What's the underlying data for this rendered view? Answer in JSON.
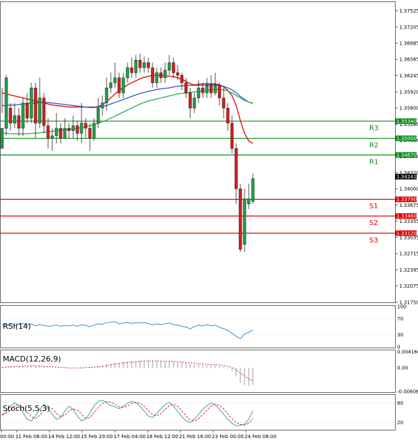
{
  "chart_data": {
    "type": "candlestick",
    "title": "",
    "colors": {
      "bull": "#22a24a",
      "bear": "#d62020",
      "ma_fast": "#e01010",
      "ma_mid": "#3a5fd0",
      "ma_slow": "#36b060",
      "support": "#e00000",
      "resistance": "#0a8a1a",
      "rsi_line": "#3b8fd9",
      "macd_signal": "#e02020",
      "macd_hist": "#999999",
      "stoch_k": "#3aa3a3",
      "stoch_d": "#e02020",
      "price_label_bg": "#000000"
    },
    "y_axis": {
      "ticks": [
        "1.37525",
        "1.37205",
        "1.36885",
        "1.36565",
        "1.36245",
        "1.35920",
        "1.35600",
        "1.35280",
        "1.34960",
        "1.34640",
        "1.34320",
        "1.34000",
        "1.33675",
        "1.33355",
        "1.33035",
        "1.32715",
        "1.32395",
        "1.32075",
        "1.31750"
      ],
      "ylim": [
        1.3175,
        1.377
      ]
    },
    "x_axis": {
      "labels": [
        "00:00",
        "11 Feb 08:00",
        "14 Feb 12:00",
        "15 Feb 20:00",
        "17 Feb 04:00",
        "18 Feb 12:00",
        "21 Feb 16:00",
        "23 Feb 00:00",
        "24 Feb 08:00"
      ]
    },
    "candles": [
      [
        1.348,
        1.352,
        1.355,
        1.36
      ],
      [
        1.352,
        1.362,
        1.3625,
        1.3505
      ],
      [
        1.356,
        1.353,
        1.357,
        1.3515
      ],
      [
        1.353,
        1.3545,
        1.357,
        1.352
      ],
      [
        1.3545,
        1.352,
        1.356,
        1.3505
      ],
      [
        1.352,
        1.357,
        1.358,
        1.3505
      ],
      [
        1.357,
        1.354,
        1.359,
        1.353
      ],
      [
        1.354,
        1.36,
        1.361,
        1.353
      ],
      [
        1.36,
        1.353,
        1.361,
        1.35
      ],
      [
        1.353,
        1.358,
        1.362,
        1.352
      ],
      [
        1.358,
        1.3525,
        1.359,
        1.351
      ],
      [
        1.3525,
        1.35,
        1.354,
        1.348
      ],
      [
        1.35,
        1.3505,
        1.352,
        1.3475
      ],
      [
        1.3505,
        1.352,
        1.355,
        1.349
      ],
      [
        1.352,
        1.35,
        1.353,
        1.349
      ],
      [
        1.35,
        1.352,
        1.354,
        1.35
      ],
      [
        1.352,
        1.3515,
        1.353,
        1.35
      ],
      [
        1.3515,
        1.3525,
        1.3545,
        1.35
      ],
      [
        1.3525,
        1.351,
        1.3535,
        1.3495
      ],
      [
        1.351,
        1.353,
        1.357,
        1.349
      ],
      [
        1.353,
        1.352,
        1.354,
        1.35
      ],
      [
        1.352,
        1.35,
        1.353,
        1.3475
      ],
      [
        1.35,
        1.353,
        1.354,
        1.3495
      ],
      [
        1.353,
        1.356,
        1.358,
        1.352
      ],
      [
        1.356,
        1.357,
        1.3585,
        1.3545
      ],
      [
        1.357,
        1.36,
        1.362,
        1.3555
      ],
      [
        1.36,
        1.361,
        1.363,
        1.359
      ],
      [
        1.361,
        1.362,
        1.365,
        1.36
      ],
      [
        1.362,
        1.359,
        1.363,
        1.358
      ],
      [
        1.359,
        1.362,
        1.363,
        1.358
      ],
      [
        1.362,
        1.364,
        1.365,
        1.361
      ],
      [
        1.364,
        1.363,
        1.366,
        1.362
      ],
      [
        1.363,
        1.3655,
        1.3665,
        1.362
      ],
      [
        1.3655,
        1.364,
        1.3668,
        1.363
      ],
      [
        1.364,
        1.365,
        1.3662,
        1.363
      ],
      [
        1.365,
        1.364,
        1.366,
        1.363
      ],
      [
        1.364,
        1.361,
        1.365,
        1.36
      ],
      [
        1.361,
        1.363,
        1.364,
        1.36
      ],
      [
        1.363,
        1.362,
        1.364,
        1.361
      ],
      [
        1.362,
        1.3635,
        1.365,
        1.361
      ],
      [
        1.3635,
        1.365,
        1.3665,
        1.3625
      ],
      [
        1.365,
        1.363,
        1.366,
        1.362
      ],
      [
        1.363,
        1.3625,
        1.3645,
        1.3615
      ],
      [
        1.3625,
        1.361,
        1.363,
        1.3595
      ],
      [
        1.361,
        1.359,
        1.362,
        1.358
      ],
      [
        1.359,
        1.356,
        1.36,
        1.354
      ],
      [
        1.356,
        1.358,
        1.359,
        1.355
      ],
      [
        1.358,
        1.36,
        1.3615,
        1.357
      ],
      [
        1.36,
        1.359,
        1.361,
        1.358
      ],
      [
        1.359,
        1.3605,
        1.362,
        1.358
      ],
      [
        1.3605,
        1.359,
        1.3625,
        1.358
      ],
      [
        1.359,
        1.3605,
        1.363,
        1.3585
      ],
      [
        1.3605,
        1.358,
        1.361,
        1.3565
      ],
      [
        1.358,
        1.356,
        1.36,
        1.354
      ],
      [
        1.356,
        1.353,
        1.357,
        1.3515
      ],
      [
        1.353,
        1.348,
        1.3545,
        1.347
      ],
      [
        1.348,
        1.34,
        1.349,
        1.337
      ],
      [
        1.34,
        1.328,
        1.341,
        1.3275
      ],
      [
        1.329,
        1.338,
        1.34,
        1.3275
      ],
      [
        1.337,
        1.338,
        1.341,
        1.336
      ],
      [
        1.3375,
        1.342,
        1.343,
        1.337
      ]
    ],
    "moving_averages": [
      {
        "name": "",
        "color_key": "ma_fast",
        "values": [
          1.359,
          1.3588,
          1.3586,
          1.3584,
          1.3582,
          1.358,
          1.3578,
          1.3576,
          1.3574,
          1.3572,
          1.357,
          1.3568,
          1.3566,
          1.3565,
          1.3564,
          1.3563,
          1.3562,
          1.3562,
          1.3562,
          1.3562,
          1.3562,
          1.3562,
          1.3562,
          1.3563,
          1.3566,
          1.3573,
          1.358,
          1.3588,
          1.3595,
          1.36,
          1.3606,
          1.361,
          1.3614,
          1.3618,
          1.3621,
          1.3623,
          1.3625,
          1.3625,
          1.3625,
          1.3624,
          1.3623,
          1.3622,
          1.362,
          1.3617,
          1.3613,
          1.3608,
          1.3606,
          1.3607,
          1.3608,
          1.3608,
          1.3608,
          1.3608,
          1.3606,
          1.3602,
          1.3595,
          1.3585,
          1.3565,
          1.3535,
          1.351,
          1.3495,
          1.349
        ]
      },
      {
        "name": "",
        "color_key": "ma_mid",
        "values": [
          1.3565,
          1.3565,
          1.3566,
          1.3566,
          1.3567,
          1.3568,
          1.3569,
          1.357,
          1.357,
          1.3571,
          1.3571,
          1.3571,
          1.357,
          1.3569,
          1.3568,
          1.3567,
          1.3566,
          1.3565,
          1.3564,
          1.3563,
          1.3562,
          1.3561,
          1.3561,
          1.3562,
          1.3563,
          1.3565,
          1.3568,
          1.3571,
          1.3574,
          1.3577,
          1.358,
          1.3583,
          1.3586,
          1.3589,
          1.3591,
          1.3593,
          1.3595,
          1.3597,
          1.3598,
          1.3599,
          1.36,
          1.3602,
          1.3603,
          1.3604,
          1.3605,
          1.3605,
          1.3605,
          1.3605,
          1.3605,
          1.3606,
          1.3606,
          1.3606,
          1.3605,
          1.3603,
          1.36,
          1.3596,
          1.359,
          1.3583,
          1.3577,
          1.3572,
          1.3569
        ]
      },
      {
        "name": "",
        "color_key": "ma_slow",
        "values": [
          1.351,
          1.351,
          1.3509,
          1.3509,
          1.3509,
          1.3509,
          1.3509,
          1.351,
          1.351,
          1.3511,
          1.3512,
          1.3513,
          1.3514,
          1.3515,
          1.3516,
          1.3517,
          1.3518,
          1.3519,
          1.352,
          1.3521,
          1.3523,
          1.3525,
          1.3527,
          1.353,
          1.3533,
          1.3536,
          1.354,
          1.3544,
          1.3548,
          1.3552,
          1.3556,
          1.356,
          1.3564,
          1.3568,
          1.3571,
          1.3574,
          1.3576,
          1.3578,
          1.358,
          1.3582,
          1.3584,
          1.3586,
          1.3588,
          1.3589,
          1.359,
          1.3591,
          1.3592,
          1.3593,
          1.3594,
          1.3595,
          1.3596,
          1.3597,
          1.3597,
          1.3596,
          1.3594,
          1.359,
          1.3585,
          1.358,
          1.3575,
          1.3572,
          1.357
        ]
      }
    ],
    "levels": [
      {
        "name": "R3",
        "value": 1.3534,
        "kind": "resistance",
        "price_label": "1.35340"
      },
      {
        "name": "R2",
        "value": 1.35,
        "kind": "resistance",
        "price_label": "1.35000"
      },
      {
        "name": "R1",
        "value": 1.3467,
        "kind": "resistance",
        "price_label": "1.34670"
      },
      {
        "name": "S1",
        "value": 1.3379,
        "kind": "support",
        "price_label": "1.33790"
      },
      {
        "name": "S2",
        "value": 1.3346,
        "kind": "support",
        "price_label": "1.33460"
      },
      {
        "name": "S3",
        "value": 1.3312,
        "kind": "support",
        "price_label": "1.33120"
      }
    ],
    "current_price": {
      "value": 1.34241,
      "label": "1.34241"
    },
    "indicators": [
      {
        "name": "RSI(14)",
        "ticks": [
          "100",
          "70",
          "30",
          "0"
        ],
        "ylim": [
          0,
          100
        ],
        "values": [
          55,
          54,
          56,
          53,
          55,
          58,
          54,
          57,
          52,
          55,
          53,
          51,
          52,
          54,
          51,
          53,
          52,
          54,
          51,
          55,
          53,
          50,
          54,
          57,
          56,
          60,
          61,
          62,
          57,
          59,
          60,
          58,
          60,
          59,
          60,
          58,
          54,
          57,
          55,
          57,
          59,
          55,
          54,
          51,
          49,
          45,
          50,
          54,
          52,
          55,
          52,
          54,
          48,
          45,
          41,
          34,
          26,
          20,
          32,
          36,
          42
        ]
      },
      {
        "name": "MACD(12,26,9)",
        "ticks": [
          "0.004166",
          "0.00",
          "-0.006068"
        ],
        "ylim": [
          -0.006068,
          0.004166
        ],
        "histogram": [
          0.0002,
          0.0003,
          0.0004,
          0.0005,
          0.0005,
          0.0006,
          0.0005,
          0.0006,
          0.0005,
          0.0004,
          0.0003,
          0.0002,
          0.0001,
          0.0,
          -0.0001,
          -0.0001,
          -0.0001,
          0.0,
          0.0,
          0.0001,
          0.0001,
          0.0001,
          0.0002,
          0.0004,
          0.0006,
          0.0009,
          0.0011,
          0.0013,
          0.0014,
          0.0015,
          0.0016,
          0.0017,
          0.0018,
          0.0019,
          0.0019,
          0.0019,
          0.0018,
          0.0018,
          0.0017,
          0.0017,
          0.0017,
          0.0016,
          0.0015,
          0.0014,
          0.0012,
          0.001,
          0.0009,
          0.0009,
          0.0008,
          0.0008,
          0.0008,
          0.0007,
          0.0006,
          0.0003,
          -0.0001,
          -0.0008,
          -0.0022,
          -0.0038,
          -0.0045,
          -0.0046,
          -0.0044
        ],
        "signal": [
          0.0001,
          0.0002,
          0.0003,
          0.0004,
          0.0004,
          0.0005,
          0.0005,
          0.0005,
          0.0005,
          0.0005,
          0.0004,
          0.0003,
          0.0003,
          0.0002,
          0.0001,
          0.0001,
          0.0,
          0.0,
          0.0,
          0.0,
          0.0001,
          0.0001,
          0.0002,
          0.0003,
          0.0004,
          0.0006,
          0.0008,
          0.001,
          0.0011,
          0.0013,
          0.0014,
          0.0015,
          0.0016,
          0.0017,
          0.0018,
          0.0018,
          0.0018,
          0.0018,
          0.0018,
          0.0017,
          0.0017,
          0.0017,
          0.0016,
          0.0015,
          0.0014,
          0.0013,
          0.0012,
          0.0011,
          0.001,
          0.0009,
          0.0009,
          0.0008,
          0.0008,
          0.0006,
          0.0004,
          0.0001,
          -0.0005,
          -0.0013,
          -0.0021,
          -0.0028,
          -0.0033
        ]
      },
      {
        "name": "Stoch(5,5,3)",
        "ticks": [
          "80",
          "20"
        ],
        "ylim": [
          0,
          100
        ],
        "k": [
          40,
          55,
          70,
          80,
          72,
          50,
          30,
          25,
          40,
          60,
          75,
          65,
          45,
          30,
          35,
          55,
          70,
          60,
          40,
          25,
          30,
          50,
          70,
          85,
          88,
          80,
          72,
          68,
          62,
          70,
          78,
          85,
          80,
          70,
          55,
          40,
          35,
          48,
          62,
          75,
          82,
          70,
          55,
          38,
          25,
          20,
          30,
          45,
          60,
          72,
          80,
          75,
          60,
          45,
          30,
          18,
          10,
          12,
          15,
          30,
          55
        ],
        "d": [
          45,
          48,
          58,
          70,
          75,
          68,
          52,
          38,
          32,
          42,
          58,
          66,
          62,
          48,
          38,
          42,
          55,
          62,
          58,
          45,
          33,
          35,
          50,
          66,
          78,
          84,
          82,
          76,
          68,
          66,
          70,
          78,
          82,
          79,
          70,
          56,
          44,
          40,
          48,
          60,
          72,
          76,
          70,
          56,
          40,
          28,
          25,
          32,
          44,
          58,
          70,
          76,
          72,
          62,
          46,
          32,
          20,
          14,
          12,
          18,
          32
        ]
      }
    ]
  }
}
